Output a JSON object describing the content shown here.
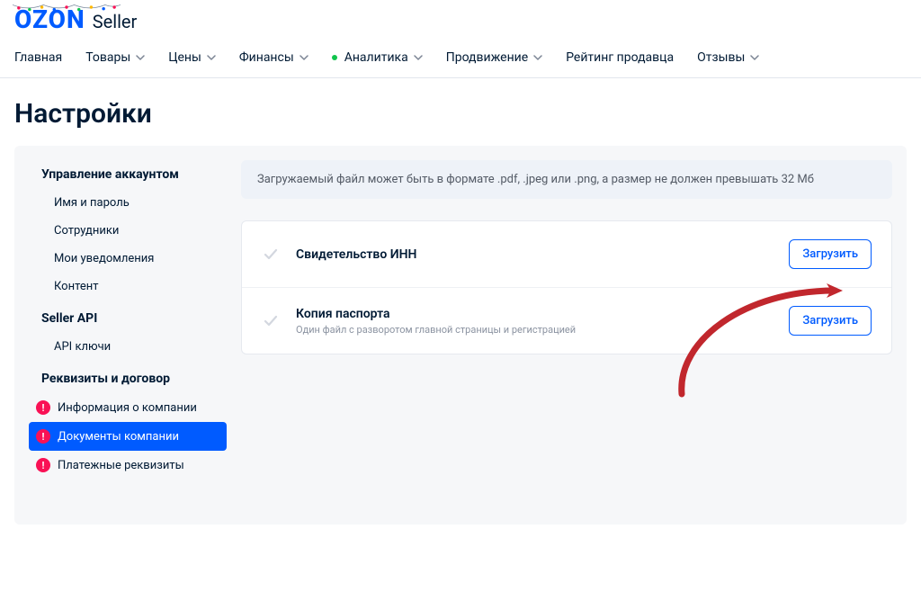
{
  "logo": {
    "brand": "OZON",
    "suffix": "Seller"
  },
  "nav": {
    "items": [
      {
        "label": "Главная",
        "chevron": false,
        "dot": false
      },
      {
        "label": "Товары",
        "chevron": true,
        "dot": false
      },
      {
        "label": "Цены",
        "chevron": true,
        "dot": false
      },
      {
        "label": "Финансы",
        "chevron": true,
        "dot": false
      },
      {
        "label": "Аналитика",
        "chevron": true,
        "dot": true
      },
      {
        "label": "Продвижение",
        "chevron": true,
        "dot": false
      },
      {
        "label": "Рейтинг продавца",
        "chevron": false,
        "dot": false
      },
      {
        "label": "Отзывы",
        "chevron": true,
        "dot": false
      }
    ]
  },
  "page_title": "Настройки",
  "sidebar": {
    "groups": [
      {
        "title": "Управление аккаунтом",
        "items": [
          {
            "label": "Имя и пароль",
            "badge": false,
            "active": false
          },
          {
            "label": "Сотрудники",
            "badge": false,
            "active": false
          },
          {
            "label": "Мои уведомления",
            "badge": false,
            "active": false
          },
          {
            "label": "Контент",
            "badge": false,
            "active": false
          }
        ]
      },
      {
        "title": "Seller API",
        "items": [
          {
            "label": "API ключи",
            "badge": false,
            "active": false
          }
        ]
      },
      {
        "title": "Реквизиты и договор",
        "items": [
          {
            "label": "Информация о компании",
            "badge": true,
            "active": false
          },
          {
            "label": "Документы компании",
            "badge": true,
            "active": true
          },
          {
            "label": "Платежные реквизиты",
            "badge": true,
            "active": false
          }
        ]
      }
    ]
  },
  "banner": "Загружаемый файл может быть в формате .pdf, .jpeg или .png, а размер не должен превышать 32 Мб",
  "documents": [
    {
      "title": "Свидетельство ИНН",
      "subtitle": "",
      "button": "Загрузить"
    },
    {
      "title": "Копия паспорта",
      "subtitle": "Один файл с разворотом главной страницы и регистрацией",
      "button": "Загрузить"
    }
  ],
  "badge_glyph": "!"
}
